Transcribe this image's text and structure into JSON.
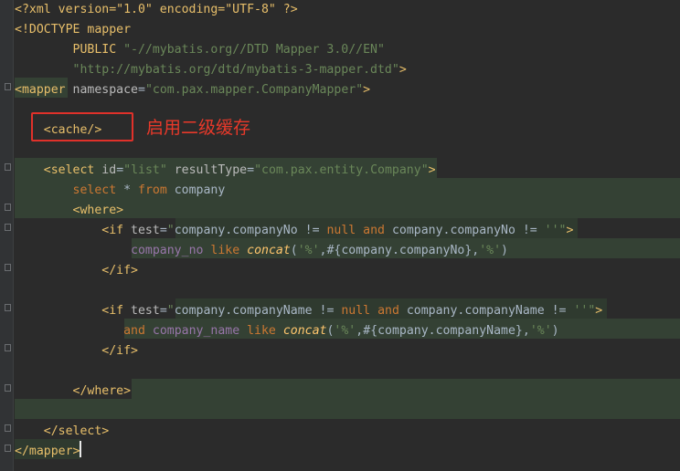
{
  "lines": [
    {
      "segments": [
        {
          "cls": "dt",
          "text": "<?xml version=\"1.0\" encoding=\"UTF-8\" ?>"
        }
      ]
    },
    {
      "segments": [
        {
          "cls": "dt",
          "text": "<!DOCTYPE mapper"
        }
      ]
    },
    {
      "segments": [
        {
          "cls": "p",
          "text": "        "
        },
        {
          "cls": "t",
          "text": "PUBLIC "
        },
        {
          "cls": "v",
          "text": "\"-//mybatis.org//DTD Mapper 3.0//EN\""
        }
      ]
    },
    {
      "segments": [
        {
          "cls": "p",
          "text": "        "
        },
        {
          "cls": "v",
          "text": "\"http://mybatis.org/dtd/mybatis-3-mapper.dtd\""
        },
        {
          "cls": "t",
          "text": ">"
        }
      ]
    },
    {
      "segments": [
        {
          "cls": "t",
          "text": "<mapper "
        },
        {
          "cls": "a",
          "text": "namespace"
        },
        {
          "cls": "p",
          "text": "="
        },
        {
          "cls": "v",
          "text": "\"com.pax.mapper.CompanyMapper\""
        },
        {
          "cls": "t",
          "text": ">"
        }
      ]
    },
    {
      "segments": []
    },
    {
      "segments": [
        {
          "cls": "p",
          "text": "    "
        },
        {
          "cls": "t",
          "text": "<cache/>"
        }
      ]
    },
    {
      "segments": []
    },
    {
      "segments": [
        {
          "cls": "p",
          "text": "    "
        },
        {
          "cls": "t",
          "text": "<select "
        },
        {
          "cls": "a",
          "text": "id"
        },
        {
          "cls": "p",
          "text": "="
        },
        {
          "cls": "v",
          "text": "\"list\" "
        },
        {
          "cls": "a",
          "text": "resultType"
        },
        {
          "cls": "p",
          "text": "="
        },
        {
          "cls": "v",
          "text": "\"com.pax.entity.Company\""
        },
        {
          "cls": "t",
          "text": ">"
        }
      ]
    },
    {
      "segments": [
        {
          "cls": "p",
          "text": "        "
        },
        {
          "cls": "k",
          "text": "select"
        },
        {
          "cls": "p",
          "text": " * "
        },
        {
          "cls": "k",
          "text": "from"
        },
        {
          "cls": "p",
          "text": " company"
        }
      ]
    },
    {
      "segments": [
        {
          "cls": "p",
          "text": "        "
        },
        {
          "cls": "t",
          "text": "<where>"
        }
      ]
    },
    {
      "segments": [
        {
          "cls": "p",
          "text": "            "
        },
        {
          "cls": "t",
          "text": "<if "
        },
        {
          "cls": "a",
          "text": "test"
        },
        {
          "cls": "p",
          "text": "="
        },
        {
          "cls": "v",
          "text": "\""
        },
        {
          "cls": "p",
          "text": "company.companyNo != "
        },
        {
          "cls": "k",
          "text": "null"
        },
        {
          "cls": "p",
          "text": " "
        },
        {
          "cls": "k",
          "text": "and"
        },
        {
          "cls": "p",
          "text": " company.companyNo != "
        },
        {
          "cls": "v",
          "text": "''\""
        },
        {
          "cls": "t",
          "text": ">"
        }
      ]
    },
    {
      "segments": [
        {
          "cls": "p",
          "text": "                "
        },
        {
          "cls": "c",
          "text": "company_no"
        },
        {
          "cls": "p",
          "text": " "
        },
        {
          "cls": "k",
          "text": "like"
        },
        {
          "cls": "p",
          "text": " "
        },
        {
          "cls": "f",
          "text": "concat"
        },
        {
          "cls": "p",
          "text": "("
        },
        {
          "cls": "v",
          "text": "'%'"
        },
        {
          "cls": "p",
          "text": ",#{company.companyNo},"
        },
        {
          "cls": "v",
          "text": "'%'"
        },
        {
          "cls": "p",
          "text": ")"
        }
      ]
    },
    {
      "segments": [
        {
          "cls": "p",
          "text": "            "
        },
        {
          "cls": "t",
          "text": "</if>"
        }
      ]
    },
    {
      "segments": []
    },
    {
      "segments": [
        {
          "cls": "p",
          "text": "            "
        },
        {
          "cls": "t",
          "text": "<if "
        },
        {
          "cls": "a",
          "text": "test"
        },
        {
          "cls": "p",
          "text": "="
        },
        {
          "cls": "v",
          "text": "\""
        },
        {
          "cls": "p",
          "text": "company.companyName != "
        },
        {
          "cls": "k",
          "text": "null"
        },
        {
          "cls": "p",
          "text": " "
        },
        {
          "cls": "k",
          "text": "and"
        },
        {
          "cls": "p",
          "text": " company.companyName != "
        },
        {
          "cls": "v",
          "text": "''\""
        },
        {
          "cls": "t",
          "text": ">"
        }
      ]
    },
    {
      "segments": [
        {
          "cls": "p",
          "text": "               "
        },
        {
          "cls": "k",
          "text": "and"
        },
        {
          "cls": "p",
          "text": " "
        },
        {
          "cls": "c",
          "text": "company_name"
        },
        {
          "cls": "p",
          "text": " "
        },
        {
          "cls": "k",
          "text": "like"
        },
        {
          "cls": "p",
          "text": " "
        },
        {
          "cls": "f",
          "text": "concat"
        },
        {
          "cls": "p",
          "text": "("
        },
        {
          "cls": "v",
          "text": "'%'"
        },
        {
          "cls": "p",
          "text": ",#{company.companyName},"
        },
        {
          "cls": "v",
          "text": "'%'"
        },
        {
          "cls": "p",
          "text": ")"
        }
      ]
    },
    {
      "segments": [
        {
          "cls": "p",
          "text": "            "
        },
        {
          "cls": "t",
          "text": "</if>"
        }
      ]
    },
    {
      "segments": []
    },
    {
      "segments": [
        {
          "cls": "p",
          "text": "        "
        },
        {
          "cls": "t",
          "text": "</where>"
        }
      ]
    },
    {
      "segments": []
    },
    {
      "segments": [
        {
          "cls": "p",
          "text": "    "
        },
        {
          "cls": "t",
          "text": "</select>"
        }
      ]
    },
    {
      "segments": [
        {
          "cls": "t",
          "text": "</mapper>"
        }
      ]
    }
  ],
  "annotation": {
    "text": "启用二级缓存"
  }
}
